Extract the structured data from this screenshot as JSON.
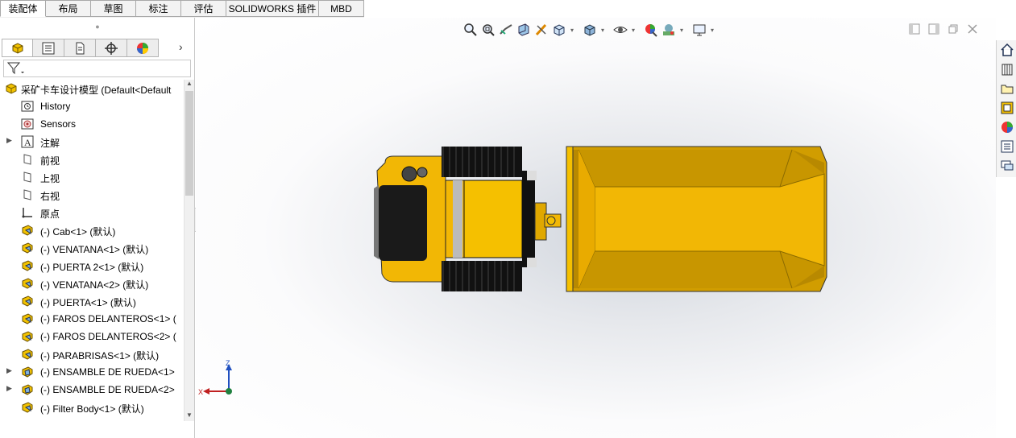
{
  "tabs": [
    "装配体",
    "布局",
    "草图",
    "标注",
    "评估",
    "SOLIDWORKS 插件",
    "MBD"
  ],
  "active_tab": "装配体",
  "panel_tabs": [
    "feature-manager-icon",
    "property-manager-icon",
    "configuration-manager-icon",
    "dimxpert-icon",
    "display-manager-icon"
  ],
  "tree": {
    "root": "采矿卡车设计模型 (Default<Default",
    "items": [
      {
        "label": "History",
        "icon": "history-icon",
        "expand": false
      },
      {
        "label": "Sensors",
        "icon": "sensors-icon",
        "expand": false
      },
      {
        "label": "注解",
        "icon": "annotations-icon",
        "expand": true
      },
      {
        "label": "前视",
        "icon": "plane-icon",
        "expand": false
      },
      {
        "label": "上视",
        "icon": "plane-icon",
        "expand": false
      },
      {
        "label": "右视",
        "icon": "plane-icon",
        "expand": false
      },
      {
        "label": "原点",
        "icon": "origin-icon",
        "expand": false
      },
      {
        "label": "(-) Cab<1> (默认)",
        "icon": "part-icon",
        "expand": false
      },
      {
        "label": "(-) VENATANA<1> (默认)",
        "icon": "part-icon",
        "expand": false
      },
      {
        "label": "(-) PUERTA 2<1> (默认)",
        "icon": "part-icon",
        "expand": false
      },
      {
        "label": "(-) VENATANA<2> (默认)",
        "icon": "part-icon",
        "expand": false
      },
      {
        "label": "(-) PUERTA<1> (默认)",
        "icon": "part-icon",
        "expand": false
      },
      {
        "label": "(-) FAROS DELANTEROS<1> (",
        "icon": "part-icon",
        "expand": false
      },
      {
        "label": "(-) FAROS DELANTEROS<2> (",
        "icon": "part-icon",
        "expand": false
      },
      {
        "label": "(-) PARABRISAS<1> (默认)",
        "icon": "part-icon",
        "expand": false
      },
      {
        "label": "(-) ENSAMBLE DE RUEDA<1>",
        "icon": "subassembly-icon",
        "expand": true
      },
      {
        "label": "(-) ENSAMBLE DE RUEDA<2>",
        "icon": "subassembly-icon",
        "expand": true
      },
      {
        "label": "(-) Filter Body<1> (默认)",
        "icon": "part-icon",
        "expand": false
      }
    ]
  },
  "headsup_toolbar": [
    "zoom-to-fit-icon",
    "zoom-to-area-icon",
    "previous-view-icon",
    "section-view-icon",
    "dynamic-annotation-icon",
    "view-orientation-icon",
    "display-style-icon",
    "hide-show-icon",
    "edit-appearance-icon",
    "apply-scene-icon",
    "view-settings-icon"
  ],
  "window_controls": [
    "tile-left-icon",
    "tile-right-icon",
    "restore-icon",
    "close-icon"
  ],
  "task_pane": [
    "home-icon",
    "design-library-icon",
    "file-explorer-icon",
    "view-palette-icon",
    "appearances-icon",
    "custom-properties-icon",
    "forum-icon"
  ],
  "triad": {
    "z": "Z",
    "x": "X"
  },
  "colors": {
    "body_yellow": "#f2b705",
    "dark_yellow": "#c79400",
    "black": "#111111"
  }
}
